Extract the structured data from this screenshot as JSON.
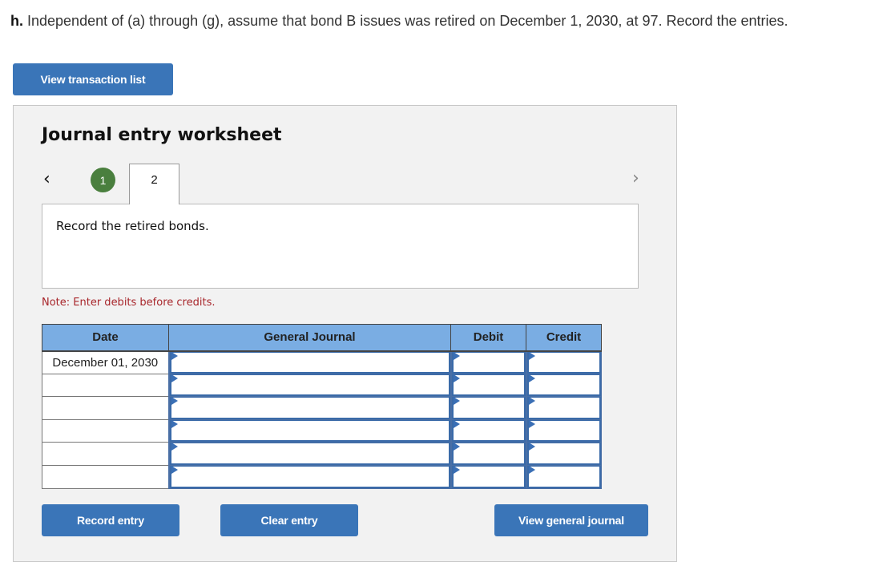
{
  "question": {
    "label": "h.",
    "text": " Independent of (a) through (g), assume that bond B issues was retired on December 1, 2030, at 97. Record the entries."
  },
  "buttons": {
    "view_transaction_list": "View transaction list",
    "record_entry": "Record entry",
    "clear_entry": "Clear entry",
    "view_general_journal": "View general journal"
  },
  "worksheet": {
    "title": "Journal entry worksheet",
    "nav": {
      "prev_icon": "‹",
      "next_icon": "›"
    },
    "steps": [
      {
        "label": "1",
        "status": "completed"
      },
      {
        "label": "2",
        "status": "active"
      }
    ],
    "instruction": "Record the retired bonds.",
    "note": "Note: Enter debits before credits."
  },
  "table": {
    "headers": [
      "Date",
      "General Journal",
      "Debit",
      "Credit"
    ],
    "rows": [
      {
        "date": "December 01, 2030",
        "account": "",
        "debit": "",
        "credit": ""
      },
      {
        "date": "",
        "account": "",
        "debit": "",
        "credit": ""
      },
      {
        "date": "",
        "account": "",
        "debit": "",
        "credit": ""
      },
      {
        "date": "",
        "account": "",
        "debit": "",
        "credit": ""
      },
      {
        "date": "",
        "account": "",
        "debit": "",
        "credit": ""
      },
      {
        "date": "",
        "account": "",
        "debit": "",
        "credit": ""
      }
    ]
  },
  "colors": {
    "button": "#3a75b8",
    "header": "#7aade3",
    "step_done": "#4a7f3e",
    "note": "#a8262b"
  }
}
